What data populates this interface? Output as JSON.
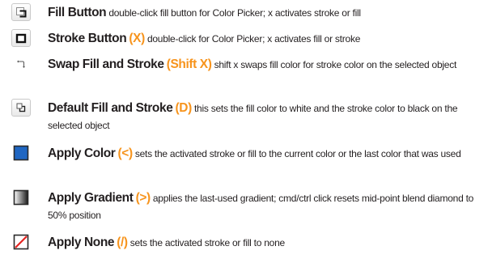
{
  "items": [
    {
      "icon": "fill-button-icon",
      "title": "Fill Button",
      "shortcut": "",
      "description": "double-click fill button for Color Picker; x activates stroke or fill"
    },
    {
      "icon": "stroke-button-icon",
      "title": "Stroke Button",
      "shortcut": "(X)",
      "description": "double-click for Color Picker; x activates fill or stroke"
    },
    {
      "icon": "swap-arrows-icon",
      "title": "Swap Fill and Stroke",
      "shortcut": "(Shift X)",
      "description": "shift x swaps fill color for stroke color on the selected object"
    },
    {
      "icon": "default-fill-stroke-icon",
      "title": "Default Fill and Stroke",
      "shortcut": "(D)",
      "description": "this sets the fill color to white and the stroke color to black on the selected object"
    },
    {
      "icon": "apply-color-icon",
      "title": "Apply Color",
      "shortcut": "(<)",
      "description": "sets the activated stroke or fill to the current color or the last color that was used"
    },
    {
      "icon": "apply-gradient-icon",
      "title": "Apply Gradient",
      "shortcut": "(>)",
      "description": "applies the last-used gradient; cmd/ctrl click resets mid-point blend diamond to 50% position"
    },
    {
      "icon": "apply-none-icon",
      "title": "Apply None",
      "shortcut": "(/)",
      "description": "sets the activated stroke or fill to none"
    }
  ],
  "colors": {
    "shortcut": "#f7941d",
    "text": "#231f20",
    "apply_color_swatch": "#1f66c2",
    "none_slash": "#e52421"
  }
}
